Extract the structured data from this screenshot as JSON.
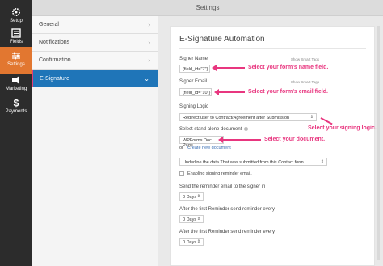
{
  "rail": {
    "items": [
      {
        "label": "Setup",
        "icon": "gear-icon"
      },
      {
        "label": "Fields",
        "icon": "fields-icon"
      },
      {
        "label": "Settings",
        "icon": "sliders-icon"
      },
      {
        "label": "Marketing",
        "icon": "megaphone-icon"
      },
      {
        "label": "Payments",
        "icon": "dollar-icon"
      }
    ]
  },
  "header": {
    "title": "Settings"
  },
  "menu": {
    "items": [
      {
        "label": "General",
        "chevron": "›"
      },
      {
        "label": "Notifications",
        "chevron": "›"
      },
      {
        "label": "Confirmation",
        "chevron": "›"
      },
      {
        "label": "E-Signature",
        "chevron": "⌄"
      }
    ]
  },
  "panel": {
    "title": "E-Signature Automation",
    "signer_name_label": "Signer Name",
    "smart_tags": "Show Smart Tags",
    "signer_name_value": "{field_id=\"7\"}",
    "signer_email_label": "Signer Email",
    "signer_email_value": "{field_id=\"10\"}",
    "signing_logic_label": "Signing Logic",
    "signing_logic_value": "Redirect user to Contract/Agreement after Submission",
    "standalone_label": "Select stand alone document",
    "standalone_value": "WPForms Doc Page",
    "or_text": "or",
    "create_link": "Create new document",
    "underline_value": "Underline the data That was submitted from this Contact form",
    "reminder_checkbox_label": "Enabling signing reminder email.",
    "send_reminder_label": "Send the reminder email to the signer in",
    "send_reminder_value": "0 Days",
    "after_first_label": "After the first Reminder send reminder every",
    "after_first_value": "0 Days",
    "after_first_label_2": "After the first Reminder send reminder every",
    "after_first_value_2": "0 Days"
  },
  "annotations": {
    "name": "Select your form's name field.",
    "email": "Select your form's email field.",
    "logic": "Select your signing logic.",
    "document": "Select your document."
  },
  "colors": {
    "rail_bg": "#2c2c2c",
    "rail_active": "#e27730",
    "menu_active": "#1f75b8",
    "annotation": "#e8367f"
  }
}
